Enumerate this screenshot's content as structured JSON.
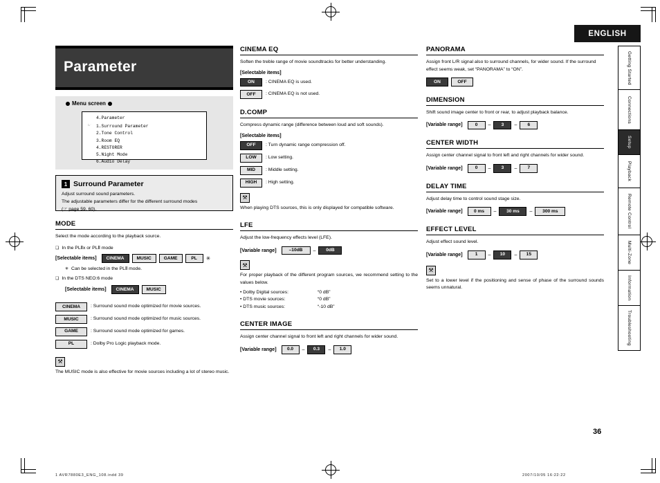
{
  "language_tab": "ENGLISH",
  "page_number": "36",
  "footer": {
    "left": "1 AVR7880E3_ENG_108.indd   39",
    "right": "2007/10/05   16:22:22"
  },
  "side_tabs": [
    {
      "label": "Getting Started",
      "active": false
    },
    {
      "label": "Connections",
      "active": false
    },
    {
      "label": "Setup",
      "active": true
    },
    {
      "label": "Playback",
      "active": false
    },
    {
      "label": "Remote Control",
      "active": false
    },
    {
      "label": "Multi-Zone",
      "active": false
    },
    {
      "label": "Information",
      "active": false
    },
    {
      "label": "Troubleshooting",
      "active": false
    }
  ],
  "title": "Parameter",
  "menu_screen": {
    "label": "Menu screen",
    "header": "4.Parameter",
    "items": [
      {
        "text": "1.Surround Parameter",
        "selected": true
      },
      {
        "text": "2.Tone Control",
        "selected": false
      },
      {
        "text": "3.Room EQ",
        "selected": false
      },
      {
        "text": "4.RESTORER",
        "selected": false
      },
      {
        "text": "5.Night Mode",
        "selected": false
      },
      {
        "text": "6.Audio Delay",
        "selected": false
      }
    ]
  },
  "callout": {
    "number": "1",
    "title": "Surround Parameter",
    "line1": "Adjust surround sound parameters.",
    "line2": "The adjustable parameters differ for the different surround modes",
    "line3": "(☞ page 59, 60)."
  },
  "col1": {
    "mode": {
      "title": "MODE",
      "desc": "Select the mode according to the playback source.",
      "sub1": "In the PLⅡx or PLⅡ mode",
      "items_label": "[Selectable items]",
      "items": [
        "CINEMA",
        "MUSIC",
        "GAME",
        "PL"
      ],
      "star_after": "✳",
      "note_star": "Can be selected in the PLⅡ mode.",
      "sub2": "In the DTS NEO:6 mode",
      "items2_label": "[Selectable items]",
      "items2": [
        "CINEMA",
        "MUSIC"
      ],
      "defs": [
        {
          "chip": "CINEMA",
          "text": ": Surround sound mode optimized for movie sources."
        },
        {
          "chip": "MUSIC",
          "text": ": Surround sound mode optimized for music sources."
        },
        {
          "chip": "GAME",
          "text": ": Surround sound mode optimized for games."
        },
        {
          "chip": "PL",
          "text": ": Dolby Pro Logic playback mode."
        }
      ],
      "note": "The MUSIC mode is also effective for movie sources including a lot of stereo music."
    }
  },
  "col2": {
    "cinema_eq": {
      "title": "CINEMA EQ",
      "desc": "Soften the treble range of movie soundtracks for better understanding.",
      "items_label": "[Selectable items]",
      "options": [
        {
          "chip": "ON",
          "selected": true,
          "text": ": CINEMA EQ is used."
        },
        {
          "chip": "OFF",
          "selected": false,
          "text": ": CINEMA EQ is not used."
        }
      ]
    },
    "dcomp": {
      "title": "D.COMP",
      "desc": "Compress dynamic range (difference between loud and soft sounds).",
      "items_label": "[Selectable items]",
      "options": [
        {
          "chip": "OFF",
          "selected": true,
          "text": ": Turn dynamic range compression off."
        },
        {
          "chip": "LOW",
          "selected": false,
          "text": ": Low setting."
        },
        {
          "chip": "MID",
          "selected": false,
          "text": ": Middle setting."
        },
        {
          "chip": "HIGH",
          "selected": false,
          "text": ": High setting."
        }
      ],
      "note": "When playing DTS sources, this is only displayed for compatible software."
    },
    "lfe": {
      "title": "LFE",
      "desc": "Adjust the low-frequency effects level (LFE).",
      "range_label": "[Variable range]",
      "range": [
        {
          "chip": "–10dB",
          "selected": false
        },
        {
          "chip": "0dB",
          "selected": true
        }
      ],
      "note": "For proper playback of the different program sources, we recommend setting to the values below.",
      "recs": [
        {
          "dt": "• Dolby Digital sources:",
          "dd": "“0 dB”"
        },
        {
          "dt": "• DTS movie sources:",
          "dd": "“0 dB”"
        },
        {
          "dt": "• DTS music sources:",
          "dd": "“-10 dB”"
        }
      ]
    },
    "center_image": {
      "title": "CENTER IMAGE",
      "desc": "Assign center channel signal to front left and right channels for wider sound.",
      "range_label": "[Variable range]",
      "range": [
        {
          "chip": "0.0",
          "selected": false
        },
        {
          "chip": "0.3",
          "selected": true
        },
        {
          "chip": "1.0",
          "selected": false
        }
      ]
    }
  },
  "col3": {
    "panorama": {
      "title": "PANORAMA",
      "desc": "Assign front L/R signal also to surround channels, for wider sound. If the surround effect seems weak, set “PANORAMA” to “ON”.",
      "range": [
        {
          "chip": "ON",
          "selected": true
        },
        {
          "chip": "OFF",
          "selected": false
        }
      ]
    },
    "dimension": {
      "title": "DIMENSION",
      "desc": "Shift sound image center to front or rear, to adjust playback balance.",
      "range_label": "[Variable range]",
      "range": [
        {
          "chip": "0",
          "selected": false
        },
        {
          "chip": "3",
          "selected": true
        },
        {
          "chip": "6",
          "selected": false
        }
      ]
    },
    "center_width": {
      "title": "CENTER WIDTH",
      "desc": "Assign center channel signal to front left and right channels for wider sound.",
      "range_label": "[Variable range]",
      "range": [
        {
          "chip": "0",
          "selected": false
        },
        {
          "chip": "3",
          "selected": true
        },
        {
          "chip": "7",
          "selected": false
        }
      ]
    },
    "delay_time": {
      "title": "DELAY TIME",
      "desc": "Adjust delay time to control sound stage size.",
      "range_label": "[Variable range]",
      "range": [
        {
          "chip": "0 ms",
          "selected": false
        },
        {
          "chip": "30 ms",
          "selected": true
        },
        {
          "chip": "300 ms",
          "selected": false
        }
      ]
    },
    "effect_level": {
      "title": "EFFECT LEVEL",
      "desc": "Adjust effect sound level.",
      "range_label": "[Variable range]",
      "range": [
        {
          "chip": "1",
          "selected": false
        },
        {
          "chip": "10",
          "selected": true
        },
        {
          "chip": "15",
          "selected": false
        }
      ],
      "note": "Set to a lower level if the positioning and sense of phase of the surround sounds seems unnatural."
    }
  },
  "icons": {
    "wrench": "⚒",
    "hand_pointer": "☞"
  }
}
